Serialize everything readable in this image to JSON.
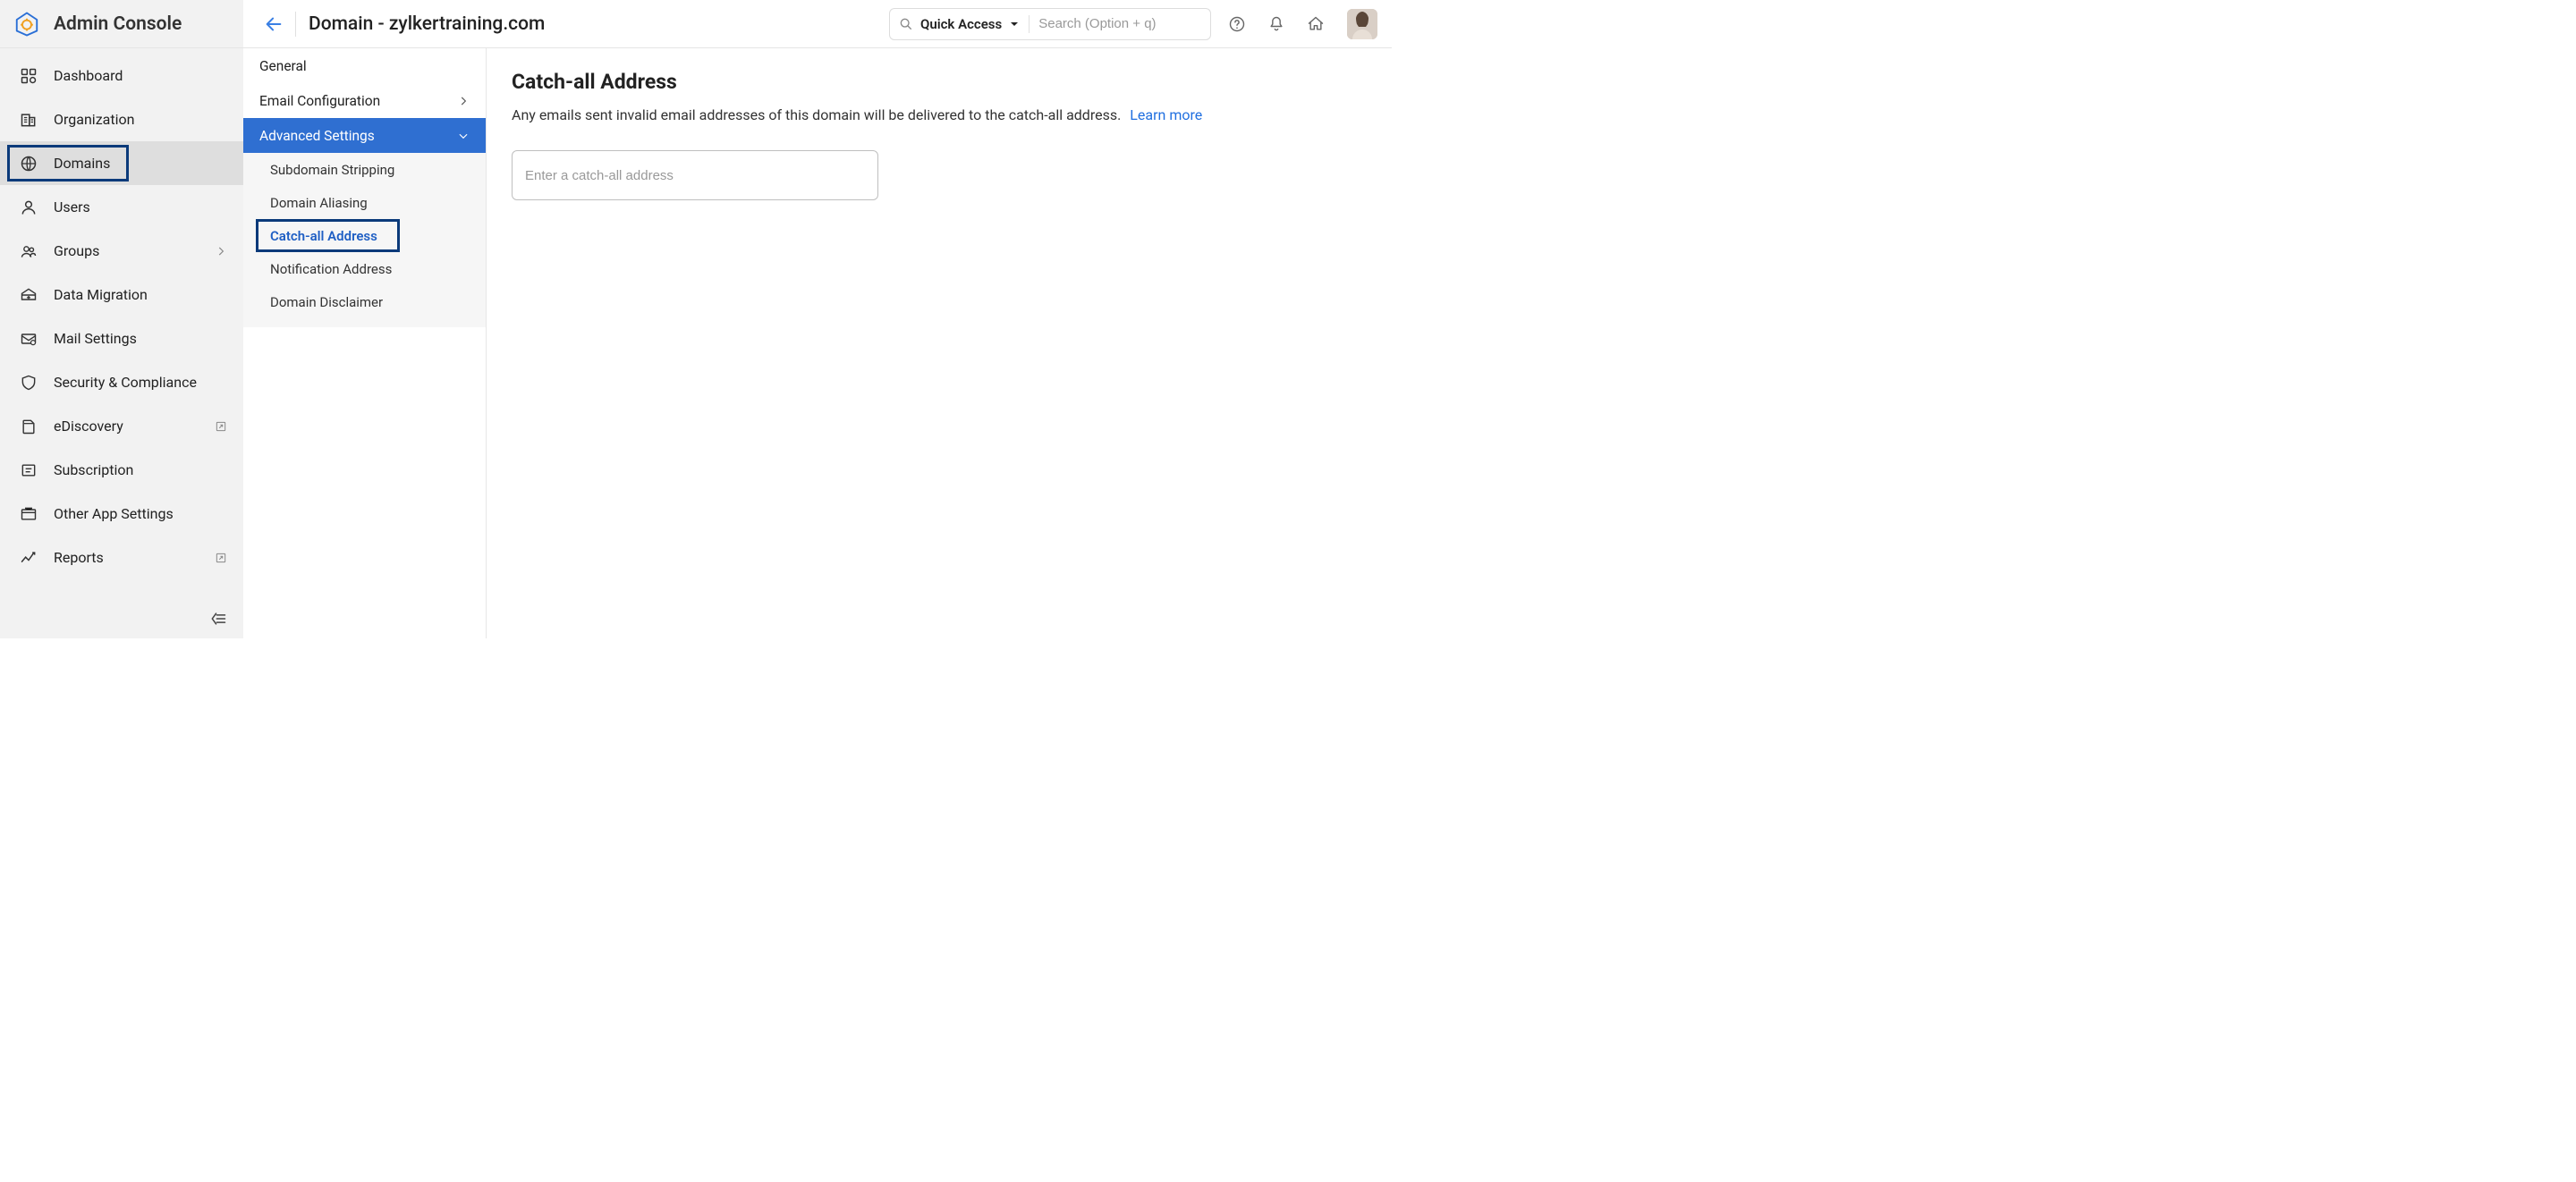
{
  "brand": {
    "title": "Admin Console"
  },
  "header": {
    "page_title": "Domain - zylkertraining.com",
    "quick_access_label": "Quick Access",
    "search_placeholder": "Search (Option + q)"
  },
  "sidebar": {
    "items": [
      {
        "label": "Dashboard"
      },
      {
        "label": "Organization"
      },
      {
        "label": "Domains"
      },
      {
        "label": "Users"
      },
      {
        "label": "Groups"
      },
      {
        "label": "Data Migration"
      },
      {
        "label": "Mail Settings"
      },
      {
        "label": "Security & Compliance"
      },
      {
        "label": "eDiscovery"
      },
      {
        "label": "Subscription"
      },
      {
        "label": "Other App Settings"
      },
      {
        "label": "Reports"
      }
    ]
  },
  "submenu": {
    "general": "General",
    "email_config": "Email Configuration",
    "advanced": "Advanced Settings",
    "children": [
      {
        "label": "Subdomain Stripping"
      },
      {
        "label": "Domain Aliasing"
      },
      {
        "label": "Catch-all Address"
      },
      {
        "label": "Notification Address"
      },
      {
        "label": "Domain Disclaimer"
      }
    ]
  },
  "content": {
    "title": "Catch-all Address",
    "description": "Any emails sent invalid email addresses of this domain will be delivered to the catch-all address.",
    "learn_more": "Learn more",
    "input_placeholder": "Enter a catch-all address"
  }
}
